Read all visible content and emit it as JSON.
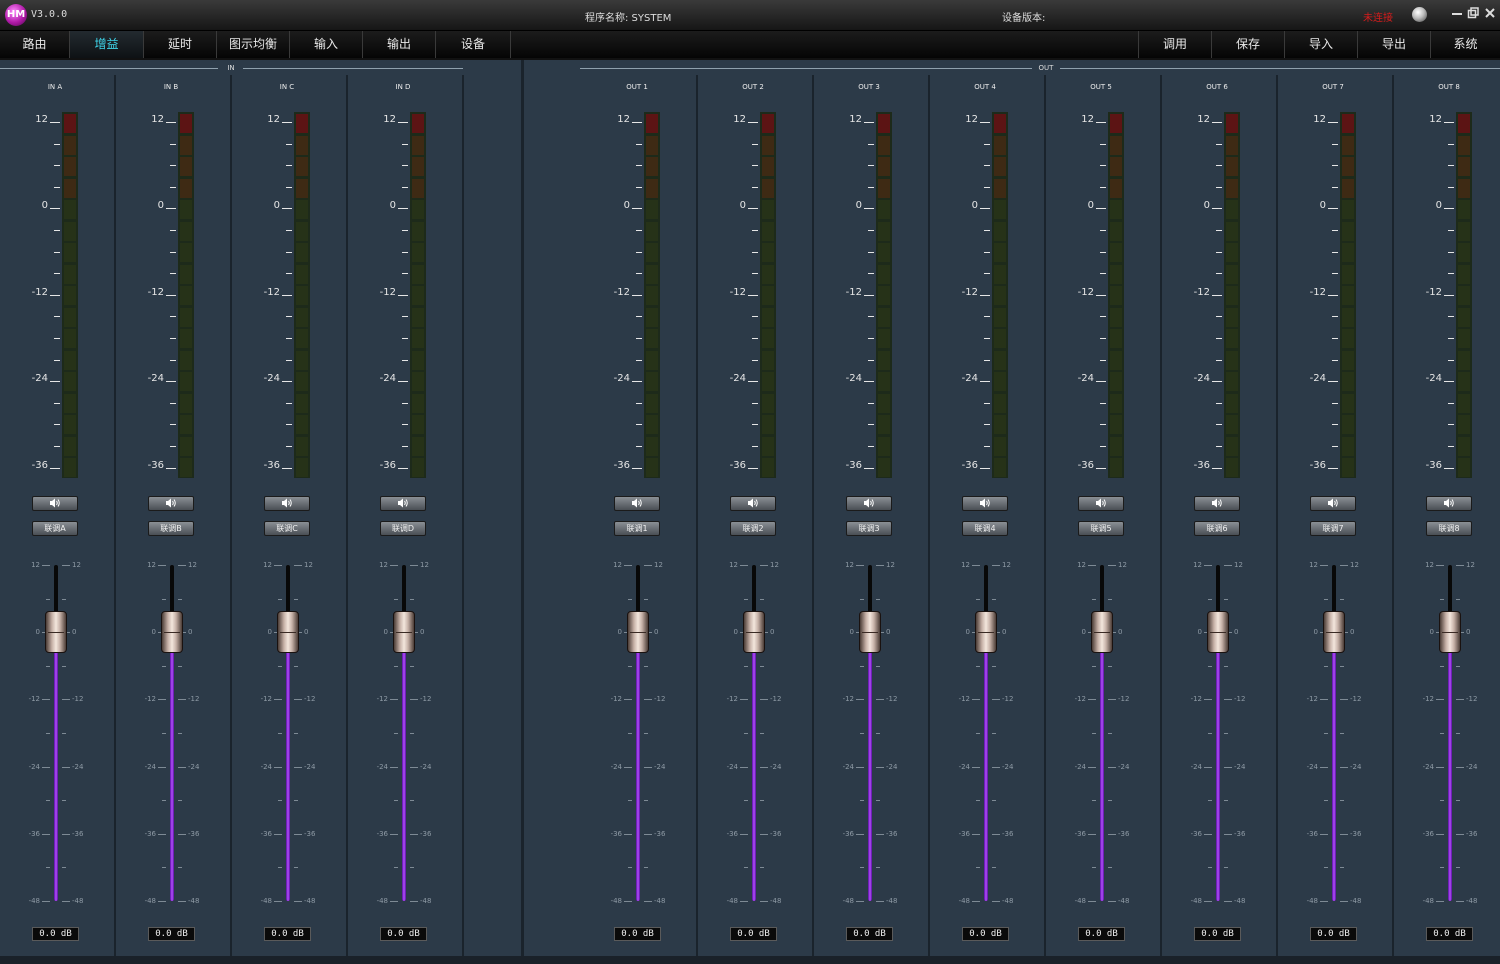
{
  "titlebar": {
    "version": "V3.0.0",
    "program_name": "程序名称: SYSTEM",
    "device_version": "设备版本:",
    "connection_status": "未连接",
    "logo_text": "HM"
  },
  "tabs_left": [
    {
      "label": "路由",
      "active": false
    },
    {
      "label": "增益",
      "active": true
    },
    {
      "label": "延时",
      "active": false
    },
    {
      "label": "图示均衡",
      "active": false
    },
    {
      "label": "输入",
      "active": false
    },
    {
      "label": "输出",
      "active": false
    },
    {
      "label": "设备",
      "active": false
    }
  ],
  "tabs_right": [
    {
      "label": "调用"
    },
    {
      "label": "保存"
    },
    {
      "label": "导入"
    },
    {
      "label": "导出"
    },
    {
      "label": "系统"
    }
  ],
  "sections": {
    "in": "IN",
    "out": "OUT"
  },
  "meter_scale": [
    "12",
    "0",
    "-12",
    "-24",
    "-36"
  ],
  "fader_scale": [
    "12",
    "0",
    "-12",
    "-24",
    "-36",
    "-48"
  ],
  "channels_in": [
    {
      "name": "IN A",
      "link": "联调A",
      "gain_db": 0,
      "value": "0.0  dB"
    },
    {
      "name": "IN B",
      "link": "联调B",
      "gain_db": 0,
      "value": "0.0  dB"
    },
    {
      "name": "IN C",
      "link": "联调C",
      "gain_db": 0,
      "value": "0.0  dB"
    },
    {
      "name": "IN D",
      "link": "联调D",
      "gain_db": 0,
      "value": "0.0  dB"
    }
  ],
  "channels_out": [
    {
      "name": "OUT 1",
      "link": "联调1",
      "gain_db": 0,
      "value": "0.0  dB"
    },
    {
      "name": "OUT 2",
      "link": "联调2",
      "gain_db": 0,
      "value": "0.0  dB"
    },
    {
      "name": "OUT 3",
      "link": "联调3",
      "gain_db": 0,
      "value": "0.0  dB"
    },
    {
      "name": "OUT 4",
      "link": "联调4",
      "gain_db": 0,
      "value": "0.0  dB"
    },
    {
      "name": "OUT 5",
      "link": "联调5",
      "gain_db": 0,
      "value": "0.0  dB"
    },
    {
      "name": "OUT 6",
      "link": "联调6",
      "gain_db": 0,
      "value": "0.0  dB"
    },
    {
      "name": "OUT 7",
      "link": "联调7",
      "gain_db": 0,
      "value": "0.0  dB"
    },
    {
      "name": "OUT 8",
      "link": "联调8",
      "gain_db": 0,
      "value": "0.0  dB"
    }
  ],
  "colors": {
    "background": "#2c3a48",
    "active_tab": "#3fd7ec",
    "disconnected": "#d41c1c",
    "fader_fill": "#9a3df0",
    "meter_clip": "#5c1414",
    "meter_hot": "#3e2a14",
    "meter_normal": "#263218"
  }
}
